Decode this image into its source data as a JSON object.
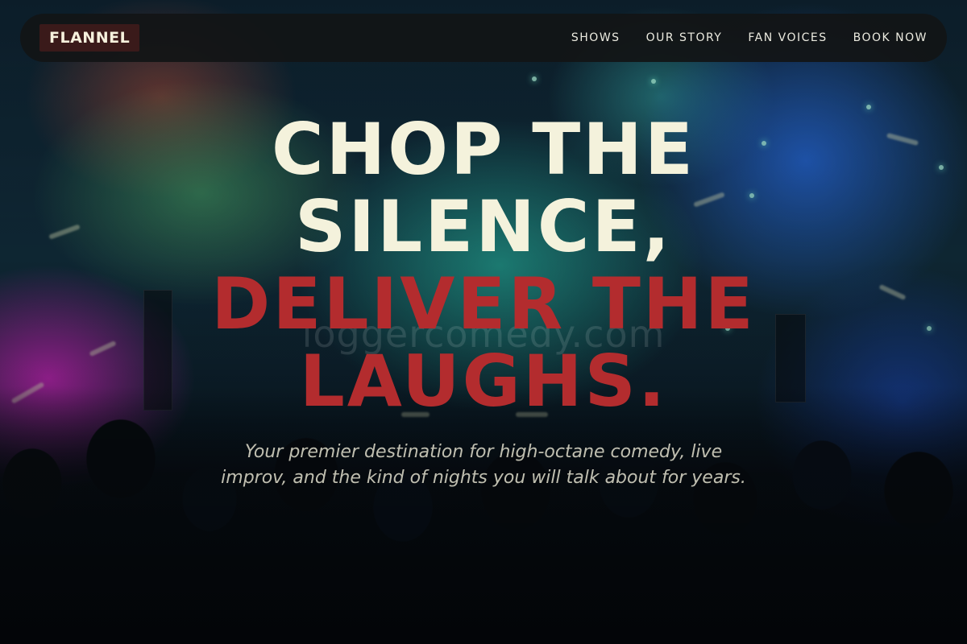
{
  "nav": {
    "logo": "FLANNEL",
    "links": [
      "SHOWS",
      "OUR STORY",
      "FAN VOICES",
      "BOOK NOW"
    ]
  },
  "hero": {
    "headline_line1": "CHOP THE",
    "headline_line2": "SILENCE,",
    "headline_line3": "DELIVER THE",
    "headline_line4": "LAUGHS.",
    "watermark": "loggercomedy.com",
    "tagline": "Your premier destination for high-octane comedy, live improv, and the kind of nights you will talk about for years."
  },
  "colors": {
    "headline_light": "#f4f2dc",
    "headline_accent": "#b32c2e",
    "nav_background": "#121416",
    "logo_background": "#3a1a1a"
  }
}
